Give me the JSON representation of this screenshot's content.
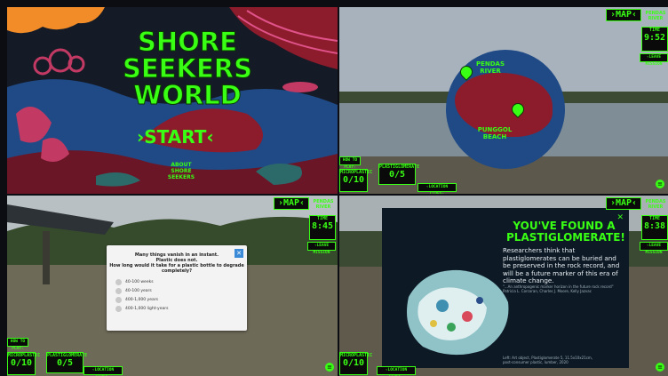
{
  "panel1": {
    "title_lines": [
      "SHORE",
      "SEEKERS",
      "WORLD"
    ],
    "start_label": "›START‹",
    "about_lines": [
      "ABOUT",
      "SHORE",
      "SEEKERS"
    ]
  },
  "hud": {
    "map_label": "›MAP‹",
    "location": [
      "PENDAS",
      "RIVER"
    ],
    "time_label": "TIME",
    "time_values": [
      "9:52",
      "8:45",
      "8:38"
    ],
    "leave_label": "‹LEAVE MISSION",
    "how_to_play": "HOW TO PLAY›",
    "microplastic_label": "MICROPLASTIC",
    "microplastic_value": "0/10",
    "plastiglomerate_label": "PLASTIGLOMERATE",
    "plastiglomerate_value": "0/5",
    "location_clues": "‹LOCATION CLUES›"
  },
  "map": {
    "places": [
      "PENDAS RIVER",
      "PUNGGOL BEACH"
    ]
  },
  "quiz": {
    "close_label": "✕",
    "question_lines": [
      "Many things vanish in an instant.",
      "Plastic does not.",
      "How long would it take for a plastic bottle to degrade",
      "completely?"
    ],
    "options": [
      "40-100 weeks",
      "40-100 years",
      "400-1,000 years",
      "400-1,000 light-years"
    ]
  },
  "found": {
    "close_label": "✕",
    "title_lines": [
      "YOU'VE FOUND A",
      "PLASTIGLOMERATE!"
    ],
    "body": "Researchers think that plastiglomerates can be buried and be preserved in the rock record, and will be a future marker of this era of climate change.",
    "note": "\"...An anthropogenic marker horizon in the future rock record\" Patricia L. Corcoran, Charles J. Moore, Kelly Jazvac",
    "caption_lines": [
      "Left: Art object, Plastiglomerate 5, 11.5x10x21cm,",
      "post-consumer plastic, lumber, 2020"
    ]
  },
  "colors": {
    "neon_green": "#39ff14",
    "title_stroke": "#0a3a00",
    "quiz_close_bg": "#3a8ad8",
    "sea_blue": "#1f4a86",
    "coral_red": "#8c1b2c"
  }
}
